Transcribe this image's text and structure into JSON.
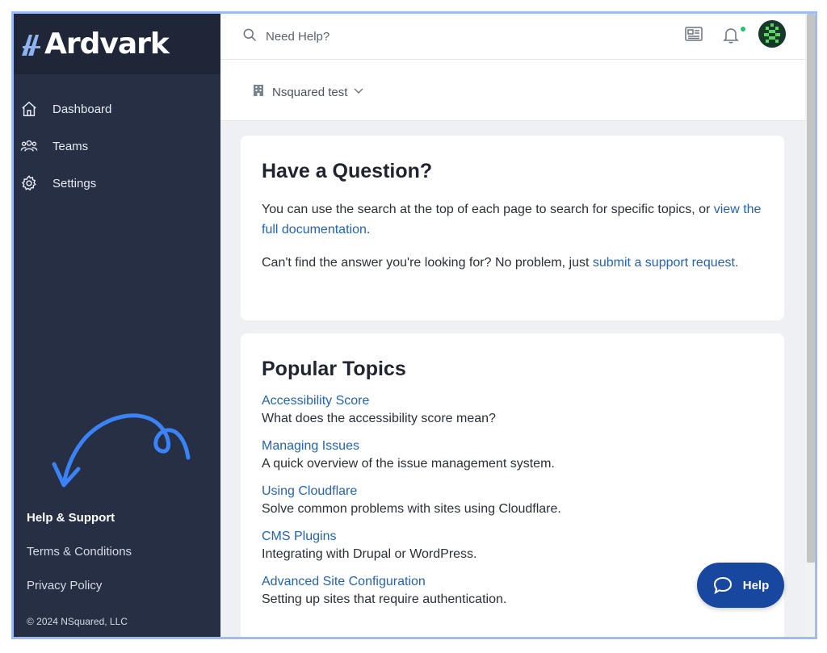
{
  "app": {
    "name": "Ardvark"
  },
  "sidebar": {
    "items": [
      {
        "label": "Dashboard",
        "icon": "home-icon"
      },
      {
        "label": "Teams",
        "icon": "users-icon"
      },
      {
        "label": "Settings",
        "icon": "gear-icon"
      }
    ],
    "footer_links": [
      {
        "label": "Help & Support",
        "active": true
      },
      {
        "label": "Terms & Conditions",
        "active": false
      },
      {
        "label": "Privacy Policy",
        "active": false
      }
    ],
    "copyright": "© 2024 NSquared, LLC"
  },
  "topbar": {
    "search_placeholder": "Need Help?",
    "icons": [
      "search-icon",
      "news-icon",
      "bell-icon",
      "avatar"
    ],
    "notification_dot_color": "#24c46b"
  },
  "org_selector": {
    "value": "Nsquared test"
  },
  "question_card": {
    "title": "Have a Question?",
    "p1_text": "You can use the search at the top of each page to search for specific topics, or ",
    "p1_link": "view the full documentation",
    "p1_end": ".",
    "p2_text": "Can't find the answer you're looking for? No problem, just ",
    "p2_link": "submit a support request."
  },
  "topics_card": {
    "title": "Popular Topics",
    "topics": [
      {
        "title": "Accessibility Score",
        "description": "What does the accessibility score mean?"
      },
      {
        "title": "Managing Issues",
        "description": "A quick overview of the issue management system."
      },
      {
        "title": "Using Cloudflare",
        "description": "Solve common problems with sites using Cloudflare."
      },
      {
        "title": "CMS Plugins",
        "description": "Integrating with Drupal or WordPress."
      },
      {
        "title": "Advanced Site Configuration",
        "description": "Setting up sites that require authentication."
      }
    ]
  },
  "help_button": {
    "label": "Help"
  },
  "colors": {
    "sidebar_bg": "#262f43",
    "link": "#2463b4",
    "help_button": "#17479e",
    "frame_border": "#9dbdf2"
  }
}
